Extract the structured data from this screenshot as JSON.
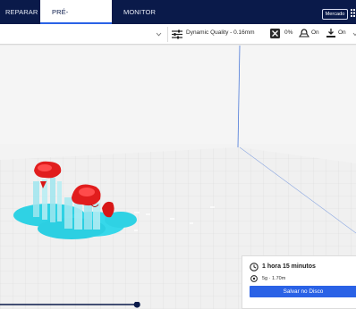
{
  "header": {
    "tabs": [
      {
        "label": "REPARAR",
        "active": false
      },
      {
        "label": "PRÉ-VISUALIZAÇÃO",
        "active": true
      },
      {
        "label": "MONITOR",
        "active": false
      }
    ],
    "marketplace_label": "Mercado"
  },
  "settings": {
    "profile_label": "Dynamic Quality - 0.16mm",
    "support_value": "0%",
    "adhesion_value": "On",
    "plate_value": "On"
  },
  "output": {
    "print_time": "1 hora 15 minutos",
    "material": "5g · 1.70m",
    "save_label": "Salvar no Disco"
  },
  "colors": {
    "nav_bg": "#0a1a4a",
    "accent": "#2a62e6",
    "model_red": "#e11d1d",
    "model_cyan": "#33d6e8"
  },
  "layer_slider": {
    "position_fraction": 0.385
  }
}
